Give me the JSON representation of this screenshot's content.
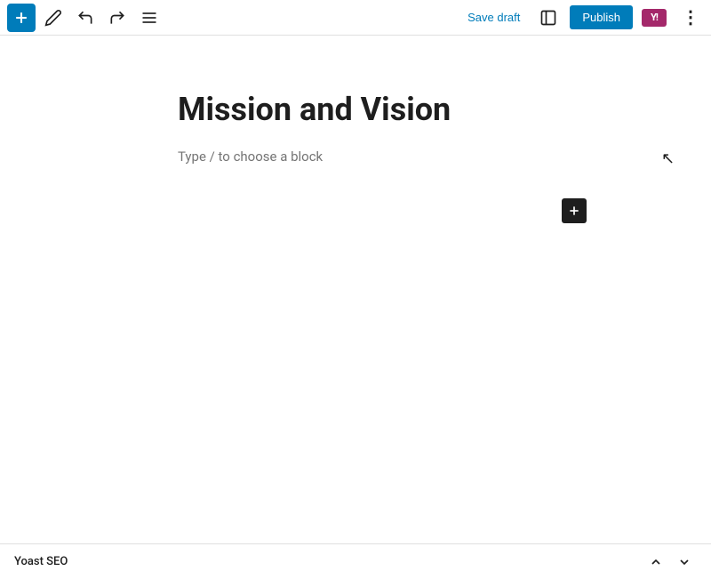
{
  "toolbar": {
    "add_label": "+",
    "save_draft_label": "Save draft",
    "publish_label": "Publish",
    "icons": {
      "pen": "✏",
      "undo": "↩",
      "redo": "↪",
      "list": "≡",
      "view": "⬜",
      "more": "⋮"
    },
    "yoast_text": "Y!",
    "colors": {
      "publish_bg": "#007cba",
      "yoast_bg": "#a4286a"
    }
  },
  "editor": {
    "title": "Mission and Vision",
    "placeholder": "Type / to choose a block"
  },
  "add_block": {
    "label": "+"
  },
  "bottom_bar": {
    "label": "Yoast SEO",
    "up_arrow": "∧",
    "down_arrow": "∨"
  }
}
